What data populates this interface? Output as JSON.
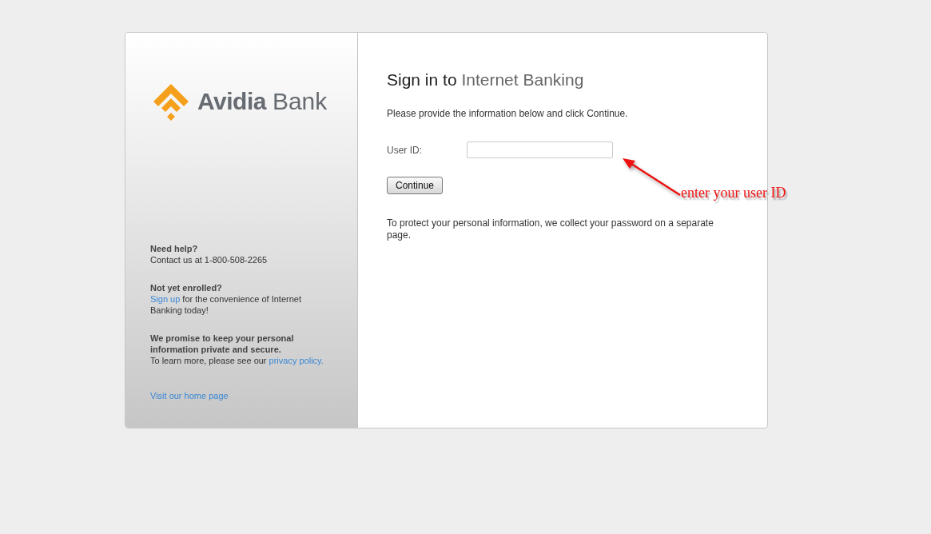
{
  "logo": {
    "name": "Avidia",
    "suffix": "Bank"
  },
  "sidebar": {
    "sections": [
      {
        "heading": "Need help?",
        "parts": [
          {
            "kind": "text",
            "text": "Contact us at 1-800-508-2265"
          }
        ]
      },
      {
        "heading": "Not yet enrolled?",
        "parts": [
          {
            "kind": "link",
            "text": "Sign up"
          },
          {
            "kind": "text",
            "text": " for the convenience of Internet Banking today!"
          }
        ]
      },
      {
        "heading": "We promise to keep your personal information private and secure.",
        "parts": [
          {
            "kind": "text",
            "text": "To learn more, please see our "
          },
          {
            "kind": "link",
            "text": "privacy policy."
          }
        ]
      },
      {
        "parts": [
          {
            "kind": "link",
            "text": "Visit our home page"
          }
        ]
      }
    ]
  },
  "main": {
    "title": "Sign in to",
    "title_product": "Internet Banking",
    "instructions": "Please provide the information below and click Continue.",
    "field": {
      "label": "User ID:"
    },
    "button": "Continue",
    "note": "To protect your personal information, we collect your password on a separate page."
  },
  "annotation": {
    "text": "enter your user ID"
  }
}
